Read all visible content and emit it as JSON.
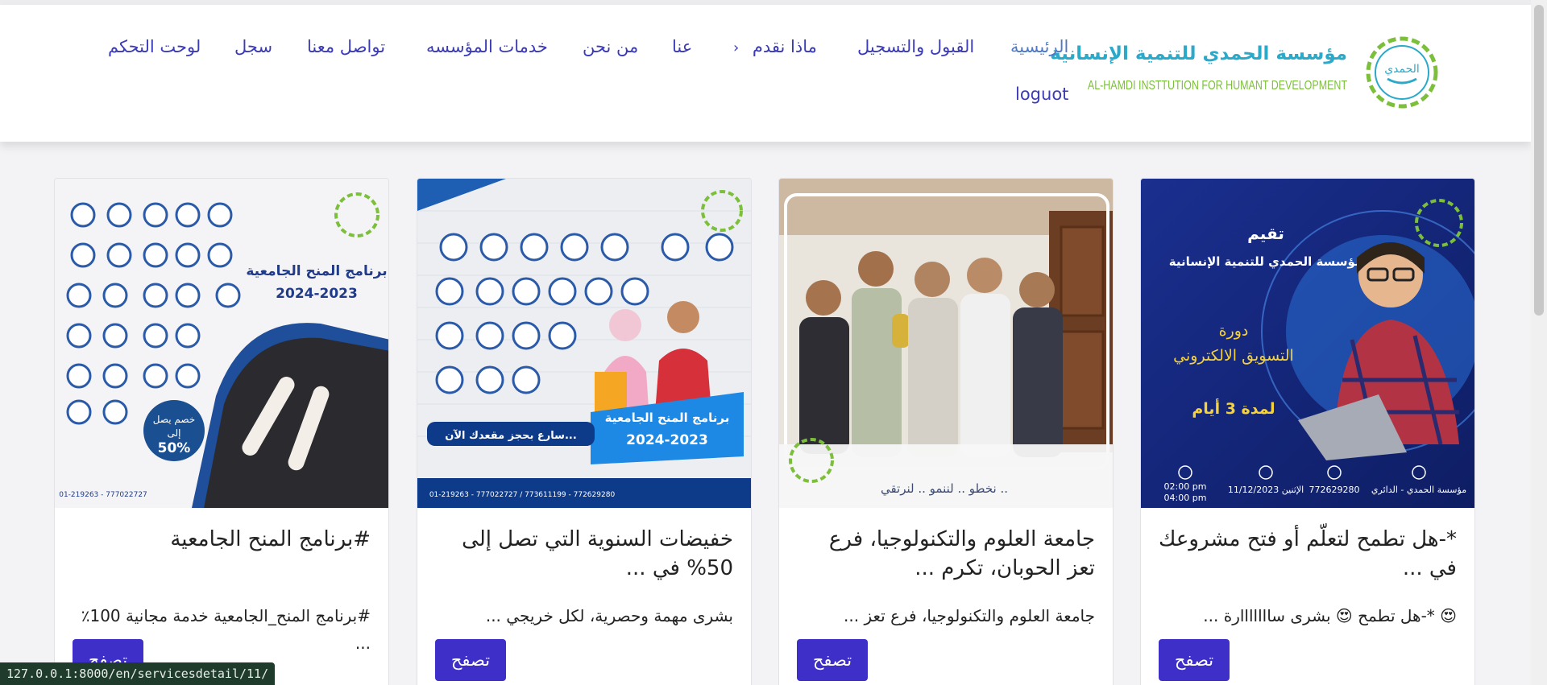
{
  "logo": {
    "title": "مؤسسة الحمدي للتنمية الإنسانية",
    "subtitle": "AL-HAMDI INSTTUTION FOR HUMANT DEVELOPMENT",
    "emblem_text": "الحمدي"
  },
  "nav": {
    "home": "الرئيسية",
    "admission": "القبول والتسجيل",
    "what_we_offer": "ماذا نقدم",
    "chevron": "‹",
    "about": "عنا",
    "who_we_are": "من نحن",
    "services": "خدمات المؤسسه",
    "contact": "تواصل معنا",
    "register": "سجل",
    "dashboard": "لوحت التحكم",
    "logout": "loguot"
  },
  "cards": [
    {
      "title": "*-هل تطمح لتعلّم أو فتح مشروعك في ...",
      "desc": "😍 *-هل تطمح 😍 بشرى سااااااارة ...",
      "button": "تصفح",
      "image": {
        "heading": "تقيم",
        "org": "مؤسسة الحمدي للتنمية الإنسانية",
        "course": "دورة",
        "course_name": "التسويق الالكتروني",
        "duration": "لمدة 3 أيام",
        "info1": "مؤسسة الحمدي - الدائري",
        "info2": "772629280",
        "info3": "الإثنين 11/12/2023",
        "time1": "02:00 pm",
        "time2": "04:00 pm"
      }
    },
    {
      "title": "جامعة العلوم والتكنولوجيا، فرع تعز الحوبان، تكرم ...",
      "desc": "جامعة العلوم والتكنولوجيا، فرع تعز ...",
      "button": "تصفح",
      "image": {
        "slogan": "نخطو .. لننمو .. لنرتقي .."
      }
    },
    {
      "title": "خفيضات السنوية التي تصل إلى 50% في ...",
      "desc": "بشرى مهمة وحصرية، لكل خريجي ...",
      "button": "تصفح",
      "image": {
        "ribbon1": "برنامج المنح الجامعية",
        "ribbon2": "2024-2023",
        "cta": "سارع بحجز مقعدك الآن...",
        "phones": "01-219263 - 777022727 / 773611199 - 772629280"
      }
    },
    {
      "title": "#برنامج المنح الجامعية",
      "desc": "#برنامج المنح_الجامعية خدمة مجانية 100٪ ...",
      "button": "تصفح",
      "image": {
        "heading": "برنامج المنح الجامعية",
        "years": "2024-2023",
        "discount1": "خصم يصل",
        "discount2": "إلى",
        "discount3": "50%",
        "phones": "01-219263 - 777022727"
      }
    }
  ],
  "status_url": "127.0.0.1:8000/en/servicesdetail/11/",
  "colors": {
    "nav": "#3b3bb8",
    "button": "#3d2fc7",
    "logo_title": "#2aa9c9",
    "logo_sub": "#7cbf3a"
  }
}
